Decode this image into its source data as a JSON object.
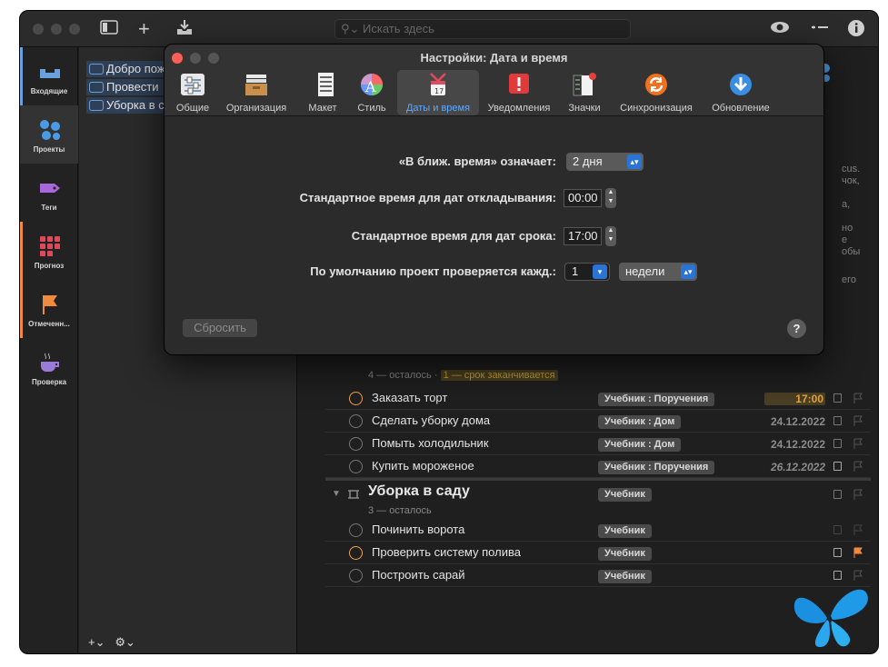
{
  "main": {
    "search_placeholder": "Искать здесь",
    "sidebar": [
      {
        "label": "Входящие",
        "color": "#6aa0e0"
      },
      {
        "label": "Проекты",
        "color": "#4a9be6"
      },
      {
        "label": "Теги",
        "color": "#a868d8"
      },
      {
        "label": "Прогноз",
        "color": "#e0495a"
      },
      {
        "label": "Отмеченн...",
        "color": "#f08a3c"
      },
      {
        "label": "Проверка",
        "color": "#9c7ad8"
      }
    ],
    "projects": [
      "Добро пож",
      "Провести",
      "Уборка в с"
    ],
    "group1": {
      "remaining": "4 — осталось ·",
      "due": "1 — срок заканчивается"
    },
    "tasks1": [
      {
        "title": "Заказать торт",
        "tag": "Учебник : Поручения",
        "date": "17:00"
      },
      {
        "title": "Сделать уборку дома",
        "tag": "Учебник : Дом",
        "date": "24.12.2022"
      },
      {
        "title": "Помыть холодильник",
        "tag": "Учебник : Дом",
        "date": "24.12.2022"
      },
      {
        "title": "Купить мороженое",
        "tag": "Учебник : Поручения",
        "date": "26.12.2022"
      }
    ],
    "group2": {
      "title": "Уборка в саду",
      "tag": "Учебник",
      "remaining": "3 — осталось"
    },
    "tasks2": [
      {
        "title": "Починить ворота",
        "tag": "Учебник"
      },
      {
        "title": "Проверить систему полива",
        "tag": "Учебник"
      },
      {
        "title": "Построить сарай",
        "tag": "Учебник"
      }
    ],
    "bg_text": [
      "cus.",
      "чок,",
      "а,",
      "но",
      "е",
      "обы",
      "его"
    ]
  },
  "prefs": {
    "title": "Настройки: Дата и время",
    "tabs": [
      "Общие",
      "Организация",
      "Макет",
      "Стиль",
      "Даты и время",
      "Уведомления",
      "Значки",
      "Синхронизация",
      "Обновление"
    ],
    "soon_label": "«В ближ. время» означает:",
    "soon_value": "2 дня",
    "defer_label": "Стандартное время для дат откладывания:",
    "defer_value": "00:00",
    "due_label": "Стандартное время для дат срока:",
    "due_value": "17:00",
    "review_label": "По умолчанию проект проверяется кажд.:",
    "review_count": "1",
    "review_unit": "недели",
    "reset": "Сбросить",
    "help": "?"
  }
}
